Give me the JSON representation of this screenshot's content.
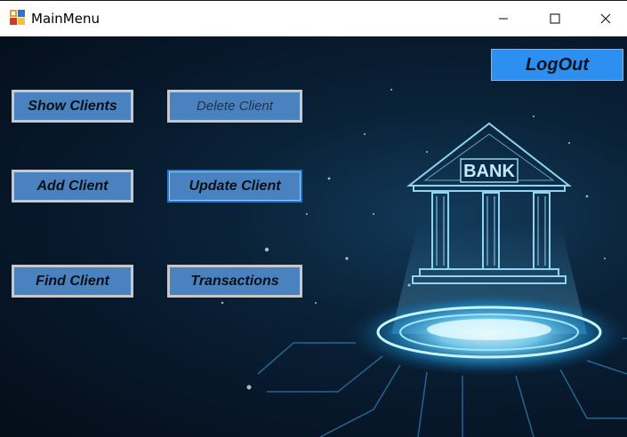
{
  "window": {
    "title": "MainMenu"
  },
  "titlebar": {
    "minimize": "–",
    "maximize": "□",
    "close": "✕"
  },
  "menu": {
    "show_clients": "Show Clients",
    "delete_client": "Delete Client",
    "add_client": "Add Client",
    "update_client": "Update Client",
    "find_client": "Find Client",
    "transactions": "Transactions",
    "logout": "LogOut"
  },
  "background": {
    "bank_sign": "BANK"
  },
  "colors": {
    "button_bg": "#4a82c0",
    "logout_bg": "#2d8fef",
    "focus_border": "#1e7bdc"
  }
}
